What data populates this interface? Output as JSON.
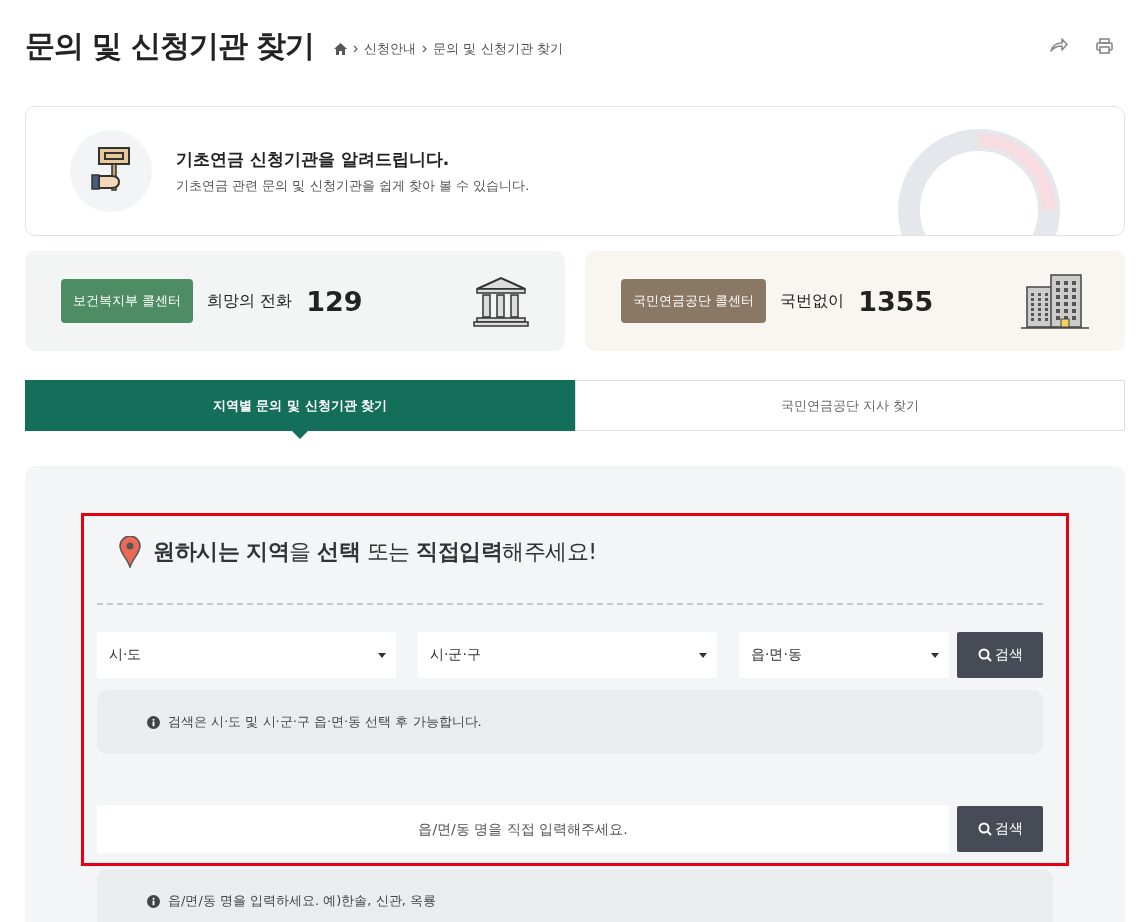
{
  "page": {
    "title": "문의 및 신청기관 찾기"
  },
  "breadcrumb": [
    "신청안내",
    "문의 및 신청기관 찾기"
  ],
  "intro": {
    "title": "기초연금 신청기관을 알려드립니다.",
    "subtitle": "기초연금 관련 문의 및 신청기관을 쉽게 찾아 볼 수 있습니다."
  },
  "call_centers": [
    {
      "badge": "보건복지부 콜센터",
      "label": "희망의 전화",
      "number": "129",
      "kind": "ministry"
    },
    {
      "badge": "국민연금공단 콜센터",
      "label": "국번없이",
      "number": "1355",
      "kind": "pension"
    }
  ],
  "tabs": [
    {
      "label": "지역별 문의 및 신청기관 찾기",
      "selected": true
    },
    {
      "label": "국민연금공단 지사 찾기",
      "selected": false
    }
  ],
  "search": {
    "heading": "**원하시는 지역**을 **선택** 또는 **직접입력**해주세요!",
    "selects": [
      "시·도",
      "시·군·구",
      "읍·면·동"
    ],
    "select_button": "검색",
    "select_note": "검색은 시·도 및 시·군·구 읍·면·동 선택 후 가능합니다.",
    "direct_placeholder": "읍/면/동 명을 직접 입력해주세요.",
    "direct_button": "검색",
    "direct_note": "읍/면/동 명을 입력하세요. 예)한솔, 신관, 옥룡"
  }
}
